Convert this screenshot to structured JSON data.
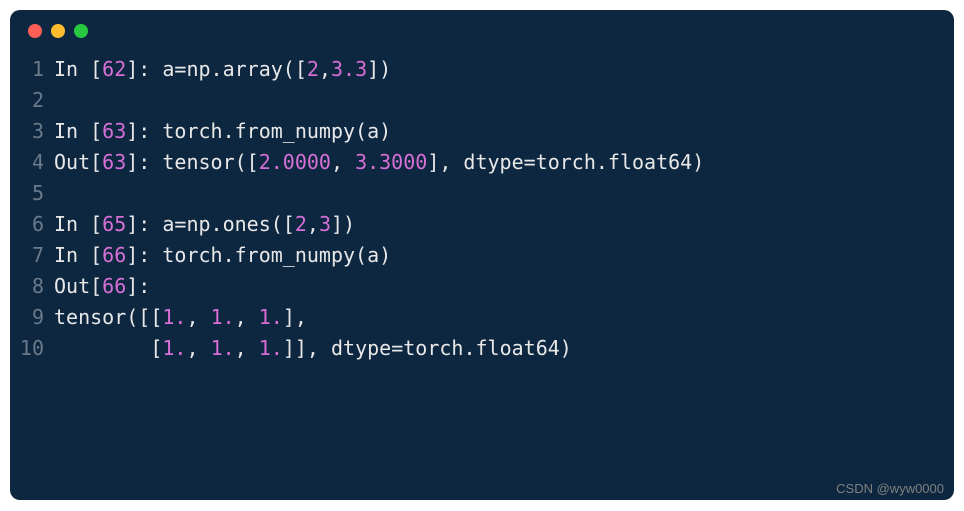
{
  "window": {
    "buttons": [
      "close",
      "minimize",
      "maximize"
    ]
  },
  "lines": [
    {
      "n": "1",
      "tokens": [
        {
          "t": "In [",
          "c": "content"
        },
        {
          "t": "62",
          "c": "num"
        },
        {
          "t": "]: a=np.array([",
          "c": "content"
        },
        {
          "t": "2",
          "c": "num"
        },
        {
          "t": ",",
          "c": "content"
        },
        {
          "t": "3.3",
          "c": "num"
        },
        {
          "t": "])",
          "c": "content"
        }
      ]
    },
    {
      "n": "2",
      "tokens": []
    },
    {
      "n": "3",
      "tokens": [
        {
          "t": "In [",
          "c": "content"
        },
        {
          "t": "63",
          "c": "num"
        },
        {
          "t": "]: torch.from_numpy(a)",
          "c": "content"
        }
      ]
    },
    {
      "n": "4",
      "tokens": [
        {
          "t": "Out[",
          "c": "content"
        },
        {
          "t": "63",
          "c": "num"
        },
        {
          "t": "]: tensor([",
          "c": "content"
        },
        {
          "t": "2.0000",
          "c": "num"
        },
        {
          "t": ", ",
          "c": "content"
        },
        {
          "t": "3.3000",
          "c": "num"
        },
        {
          "t": "], dtype=torch.float64)",
          "c": "content"
        }
      ]
    },
    {
      "n": "5",
      "tokens": []
    },
    {
      "n": "6",
      "tokens": [
        {
          "t": "In [",
          "c": "content"
        },
        {
          "t": "65",
          "c": "num"
        },
        {
          "t": "]: a=np.ones([",
          "c": "content"
        },
        {
          "t": "2",
          "c": "num"
        },
        {
          "t": ",",
          "c": "content"
        },
        {
          "t": "3",
          "c": "num"
        },
        {
          "t": "])",
          "c": "content"
        }
      ]
    },
    {
      "n": "7",
      "tokens": [
        {
          "t": "In [",
          "c": "content"
        },
        {
          "t": "66",
          "c": "num"
        },
        {
          "t": "]: torch.from_numpy(a)",
          "c": "content"
        }
      ]
    },
    {
      "n": "8",
      "tokens": [
        {
          "t": "Out[",
          "c": "content"
        },
        {
          "t": "66",
          "c": "num"
        },
        {
          "t": "]:",
          "c": "content"
        }
      ]
    },
    {
      "n": "9",
      "tokens": [
        {
          "t": "tensor([[",
          "c": "content"
        },
        {
          "t": "1.",
          "c": "num"
        },
        {
          "t": ", ",
          "c": "content"
        },
        {
          "t": "1.",
          "c": "num"
        },
        {
          "t": ", ",
          "c": "content"
        },
        {
          "t": "1.",
          "c": "num"
        },
        {
          "t": "],",
          "c": "content"
        }
      ]
    },
    {
      "n": "10",
      "tokens": [
        {
          "t": "        [",
          "c": "content"
        },
        {
          "t": "1.",
          "c": "num"
        },
        {
          "t": ", ",
          "c": "content"
        },
        {
          "t": "1.",
          "c": "num"
        },
        {
          "t": ", ",
          "c": "content"
        },
        {
          "t": "1.",
          "c": "num"
        },
        {
          "t": "]], dtype=torch.float64)",
          "c": "content"
        }
      ]
    }
  ],
  "watermark": "CSDN @wyw0000"
}
